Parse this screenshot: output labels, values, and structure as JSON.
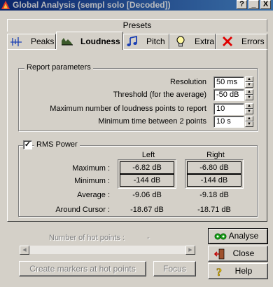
{
  "window": {
    "title": "Global Analysis (sempl solo [Decoded])",
    "controls": {
      "help": "?",
      "minimize": "_",
      "close": "X"
    }
  },
  "presets": {
    "label": "Presets"
  },
  "tabs": [
    {
      "label": "Peaks",
      "icon": "peaks-icon"
    },
    {
      "label": "Loudness",
      "icon": "loudness-icon",
      "active": true
    },
    {
      "label": "Pitch",
      "icon": "music-notes-icon"
    },
    {
      "label": "Extra",
      "icon": "lightbulb-icon"
    },
    {
      "label": "Errors",
      "icon": "red-x-icon"
    }
  ],
  "report": {
    "title": "Report parameters",
    "resolution_label": "Resolution",
    "resolution_value": "50 ms",
    "threshold_label": "Threshold (for the average)",
    "threshold_value": "-50 dB",
    "max_points_label": "Maximum number of loudness points to report",
    "max_points_value": "10",
    "min_time_label": "Minimum time between 2 points",
    "min_time_value": "10 s"
  },
  "rms": {
    "checkbox_checked": true,
    "title": "RMS Power",
    "col_left": "Left",
    "col_right": "Right",
    "rows": [
      {
        "label": "Maximum :",
        "left": "-6.82 dB",
        "right": "-6.80 dB",
        "boxed": true
      },
      {
        "label": "Minimum :",
        "left": "-144 dB",
        "right": "-144 dB",
        "boxed": true
      },
      {
        "label": "Average :",
        "left": "-9.06 dB",
        "right": "-9.18 dB",
        "boxed": false
      },
      {
        "label": "Around Cursor :",
        "left": "-18.67 dB",
        "right": "-18.71 dB",
        "boxed": false
      }
    ]
  },
  "hotpoints": {
    "label": "Number of hot points :",
    "value": "-",
    "create_markers_label": "Create markers at hot points",
    "focus_label": "Focus"
  },
  "buttons": {
    "analyse": "Analyse",
    "close": "Close",
    "help": "Help"
  },
  "colors": {
    "titlebar_start": "#0a246a",
    "titlebar_end": "#3a6ea5",
    "face": "#d4d0c8"
  }
}
